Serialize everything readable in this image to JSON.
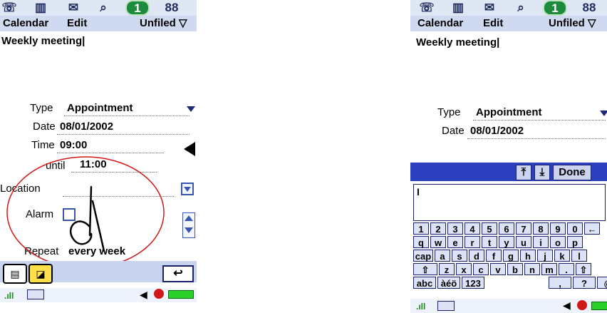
{
  "icons": [
    "phone-icon",
    "book-icon",
    "mail-icon",
    "browser-icon",
    "calendar-icon",
    "apps-icon"
  ],
  "icon_glyphs": {
    "phone": "☏",
    "book": "𝕞",
    "mail": "✉",
    "browser": "⌕",
    "calendar": "1",
    "apps": "88"
  },
  "menu": {
    "app": "Calendar",
    "edit": "Edit",
    "category": "Unfiled"
  },
  "event": {
    "title": "Weekly meeting|",
    "type_label": "Type",
    "type_value": "Appointment",
    "date_label": "Date",
    "date_value": "08/01/2002",
    "time_label": "Time",
    "time_value": "09:00",
    "until_label": "until",
    "until_value": "11:00",
    "location_label": "Location",
    "alarm_label": "Alarm",
    "repeat_label": "Repeat",
    "repeat_value": "every week"
  },
  "keyboard": {
    "done_label": "Done",
    "cursor": "I",
    "row1": [
      "1",
      "2",
      "3",
      "4",
      "5",
      "6",
      "7",
      "8",
      "9",
      "0",
      "←"
    ],
    "row2": [
      "q",
      "w",
      "e",
      "r",
      "t",
      "y",
      "u",
      "i",
      "o",
      "p"
    ],
    "row3": [
      "cap",
      "a",
      "s",
      "d",
      "f",
      "g",
      "h",
      "j",
      "k",
      "l"
    ],
    "row4": [
      "⇧",
      "z",
      "x",
      "c",
      "v",
      "b",
      "n",
      "m",
      ".",
      "⇧"
    ],
    "row5": [
      "abc",
      "àéö",
      "123",
      ",",
      "?",
      "@"
    ]
  },
  "colors": {
    "annotation": "#d01818",
    "accent": "#2b3fbf"
  }
}
